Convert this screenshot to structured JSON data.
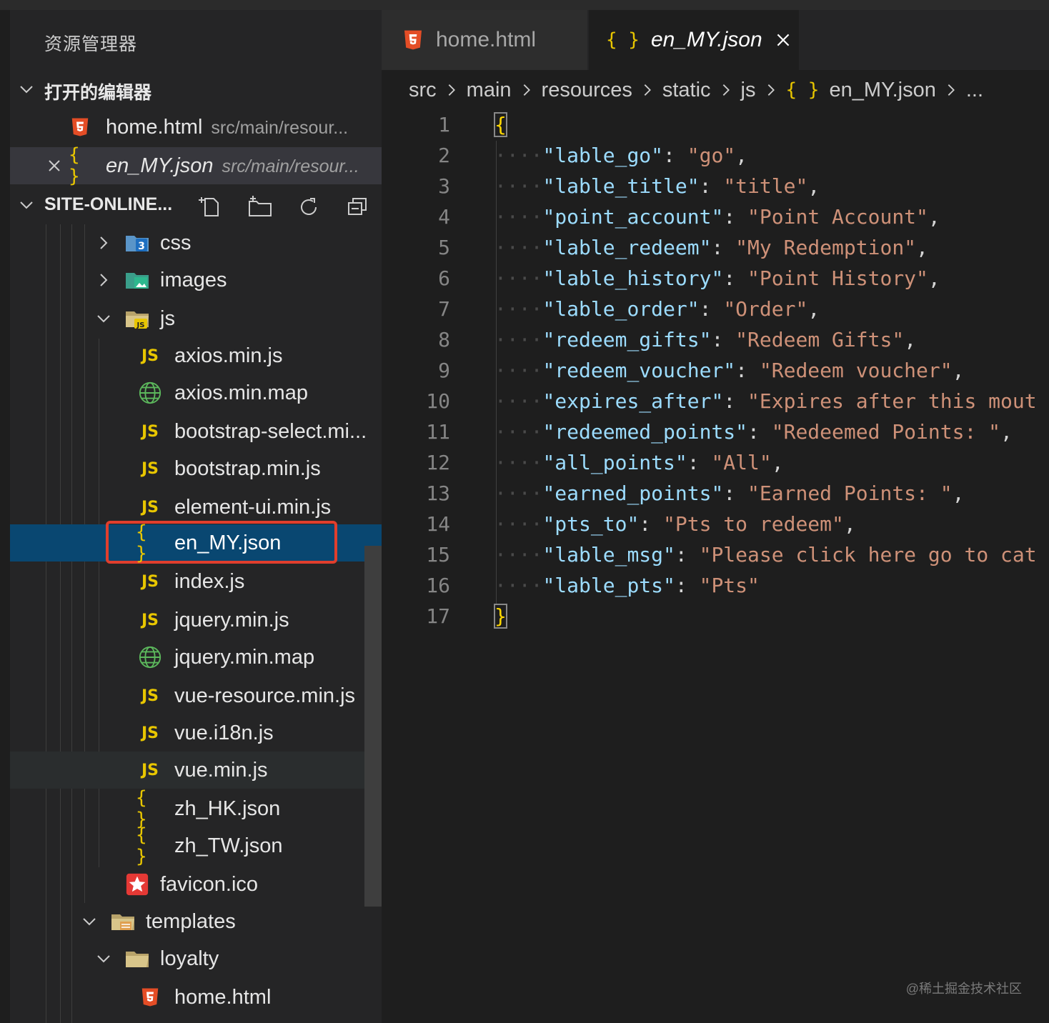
{
  "sidebar": {
    "title": "资源管理器",
    "open_editors": {
      "label": "打开的编辑器",
      "items": [
        {
          "name": "home.html",
          "hint": "src/main/resour..."
        },
        {
          "name": "en_MY.json",
          "hint": "src/main/resour..."
        }
      ]
    },
    "project": {
      "label": "SITE-ONLINE...",
      "tree": [
        {
          "label": "css",
          "icon": "css-folder-icon"
        },
        {
          "label": "images",
          "icon": "images-folder-icon"
        },
        {
          "label": "js",
          "icon": "js-folder-icon"
        },
        {
          "label": "axios.min.js",
          "icon": "js-icon"
        },
        {
          "label": "axios.min.map",
          "icon": "globe-icon"
        },
        {
          "label": "bootstrap-select.mi...",
          "icon": "js-icon"
        },
        {
          "label": "bootstrap.min.js",
          "icon": "js-icon"
        },
        {
          "label": "element-ui.min.js",
          "icon": "js-icon"
        },
        {
          "label": "en_MY.json",
          "icon": "json-icon"
        },
        {
          "label": "index.js",
          "icon": "js-icon"
        },
        {
          "label": "jquery.min.js",
          "icon": "js-icon"
        },
        {
          "label": "jquery.min.map",
          "icon": "globe-icon"
        },
        {
          "label": "vue-resource.min.js",
          "icon": "js-icon"
        },
        {
          "label": "vue.i18n.js",
          "icon": "js-icon"
        },
        {
          "label": "vue.min.js",
          "icon": "js-icon"
        },
        {
          "label": "zh_HK.json",
          "icon": "json-icon"
        },
        {
          "label": "zh_TW.json",
          "icon": "json-icon"
        },
        {
          "label": "favicon.ico",
          "icon": "star-icon"
        },
        {
          "label": "templates",
          "icon": "templates-folder-icon"
        },
        {
          "label": "loyalty",
          "icon": "folder-icon"
        },
        {
          "label": "home.html",
          "icon": "html5-icon"
        }
      ]
    }
  },
  "tabs": [
    {
      "label": "home.html",
      "icon": "html5-icon",
      "active": false
    },
    {
      "label": "en_MY.json",
      "icon": "json-icon",
      "active": true
    }
  ],
  "breadcrumbs": [
    "src",
    "main",
    "resources",
    "static",
    "js",
    "en_MY.json",
    "..."
  ],
  "code": {
    "line_numbers": [
      "1",
      "2",
      "3",
      "4",
      "5",
      "6",
      "7",
      "8",
      "9",
      "10",
      "11",
      "12",
      "13",
      "14",
      "15",
      "16",
      "17"
    ],
    "open_brace": "{",
    "close_brace": "}",
    "entries": [
      {
        "key": "\"lable_go\"",
        "value": "\"go\"",
        "tail": ","
      },
      {
        "key": "\"lable_title\"",
        "value": "\"title\"",
        "tail": ","
      },
      {
        "key": "\"point_account\"",
        "value": "\"Point Account\"",
        "tail": ","
      },
      {
        "key": "\"lable_redeem\"",
        "value": "\"My Redemption\"",
        "tail": ","
      },
      {
        "key": "\"lable_history\"",
        "value": "\"Point History\"",
        "tail": ","
      },
      {
        "key": "\"lable_order\"",
        "value": "\"Order\"",
        "tail": ","
      },
      {
        "key": "\"redeem_gifts\"",
        "value": "\"Redeem Gifts\"",
        "tail": ","
      },
      {
        "key": "\"redeem_voucher\"",
        "value": "\"Redeem voucher\"",
        "tail": ","
      },
      {
        "key": "\"expires_after\"",
        "value": "\"Expires after this mout",
        "tail": ""
      },
      {
        "key": "\"redeemed_points\"",
        "value": "\"Redeemed Points: \"",
        "tail": ","
      },
      {
        "key": "\"all_points\"",
        "value": "\"All\"",
        "tail": ","
      },
      {
        "key": "\"earned_points\"",
        "value": "\"Earned Points: \"",
        "tail": ","
      },
      {
        "key": "\"pts_to\"",
        "value": "\"Pts to redeem\"",
        "tail": ","
      },
      {
        "key": "\"lable_msg\"",
        "value": "\"Please click here go to cat",
        "tail": ""
      },
      {
        "key": "\"lable_pts\"",
        "value": "\"Pts\"",
        "tail": ""
      }
    ]
  },
  "watermark": "@稀土掘金技术社区",
  "colors": {
    "selection": "#094771",
    "highlight_border": "#e03e2d",
    "json_key": "#9cdcfe",
    "json_string": "#ce9178",
    "js_icon": "#e8c600",
    "html_icon": "#e44d26"
  }
}
